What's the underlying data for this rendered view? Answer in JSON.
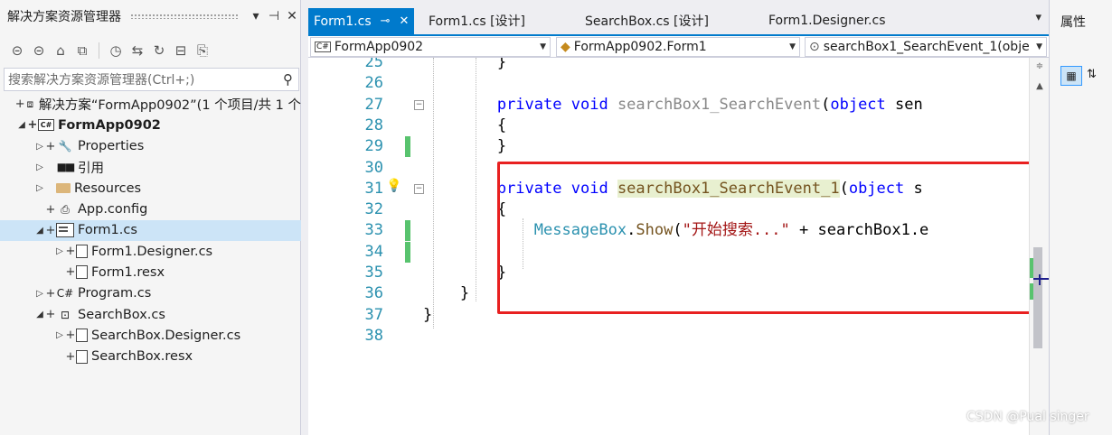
{
  "solution_explorer": {
    "title": "解决方案资源管理器",
    "title_buttons": [
      "▾",
      "⊣",
      "✕"
    ],
    "search_placeholder": "搜索解决方案资源管理器(Ctrl+;)",
    "search_icon": "search-icon",
    "tree": [
      {
        "label": "解决方案“FormApp0902”(1 个项目/共 1 个",
        "icon": "solution-icon",
        "indent": 0,
        "expander": "",
        "plus": "+",
        "bold": false
      },
      {
        "label": "FormApp0902",
        "icon": "csharp-project-icon",
        "indent": 1,
        "expander": "◢",
        "plus": "+",
        "bold": true
      },
      {
        "label": "Properties",
        "icon": "wrench-icon",
        "indent": 2,
        "expander": "▷",
        "plus": "+",
        "bold": false
      },
      {
        "label": "引用",
        "icon": "references-icon",
        "indent": 2,
        "expander": "▷",
        "plus": "",
        "bold": false
      },
      {
        "label": "Resources",
        "icon": "folder-icon",
        "indent": 2,
        "expander": "▷",
        "plus": "",
        "bold": false
      },
      {
        "label": "App.config",
        "icon": "config-file-icon",
        "indent": 2,
        "expander": "",
        "plus": "+",
        "bold": false
      },
      {
        "label": "Form1.cs",
        "icon": "form-icon",
        "indent": 2,
        "expander": "◢",
        "plus": "+",
        "bold": false,
        "selected": true
      },
      {
        "label": "Form1.Designer.cs",
        "icon": "cs-file-icon",
        "indent": 3,
        "expander": "▷",
        "plus": "+",
        "bold": false
      },
      {
        "label": "Form1.resx",
        "icon": "resx-file-icon",
        "indent": 3,
        "expander": "",
        "plus": "+",
        "bold": false
      },
      {
        "label": "Program.cs",
        "icon": "csharp-file-icon",
        "indent": 2,
        "expander": "▷",
        "plus": "+",
        "bold": false
      },
      {
        "label": "SearchBox.cs",
        "icon": "usercontrol-icon",
        "indent": 2,
        "expander": "◢",
        "plus": "+",
        "bold": false
      },
      {
        "label": "SearchBox.Designer.cs",
        "icon": "cs-file-icon",
        "indent": 3,
        "expander": "▷",
        "plus": "+",
        "bold": false
      },
      {
        "label": "SearchBox.resx",
        "icon": "resx-file-icon",
        "indent": 3,
        "expander": "",
        "plus": "+",
        "bold": false
      }
    ]
  },
  "editor": {
    "tabs": [
      {
        "label": "Form1.cs",
        "active": true
      },
      {
        "label": "Form1.cs [设计]",
        "active": false
      },
      {
        "label": "SearchBox.cs [设计]",
        "active": false
      },
      {
        "label": "Form1.Designer.cs",
        "active": false
      }
    ],
    "tab_overflow_icon": "▾",
    "nav": {
      "project": "FormApp0902",
      "class": "FormApp0902.Form1",
      "member": "searchBox1_SearchEvent_1(obje"
    },
    "lines": [
      {
        "n": "25",
        "code": "            }"
      },
      {
        "n": "26",
        "code": ""
      },
      {
        "n": "27",
        "code": "            private void searchBox1_SearchEvent(object sen"
      },
      {
        "n": "28",
        "code": "            {"
      },
      {
        "n": "29",
        "code": "            }"
      },
      {
        "n": "30",
        "code": ""
      },
      {
        "n": "31",
        "code": "            private void searchBox1_SearchEvent_1(object s"
      },
      {
        "n": "32",
        "code": "            {"
      },
      {
        "n": "33",
        "code": "                MessageBox.Show(\"开始搜索...\" + searchBox1.e"
      },
      {
        "n": "34",
        "code": ""
      },
      {
        "n": "35",
        "code": "            }"
      },
      {
        "n": "36",
        "code": "        }"
      },
      {
        "n": "37",
        "code": "    }"
      },
      {
        "n": "38",
        "code": ""
      }
    ]
  },
  "properties": {
    "title": "属性"
  },
  "watermark": "CSDN @Pual singer",
  "colors": {
    "accent": "#007acc",
    "highlight_box": "#e82020",
    "change_bar": "#58c36e"
  }
}
